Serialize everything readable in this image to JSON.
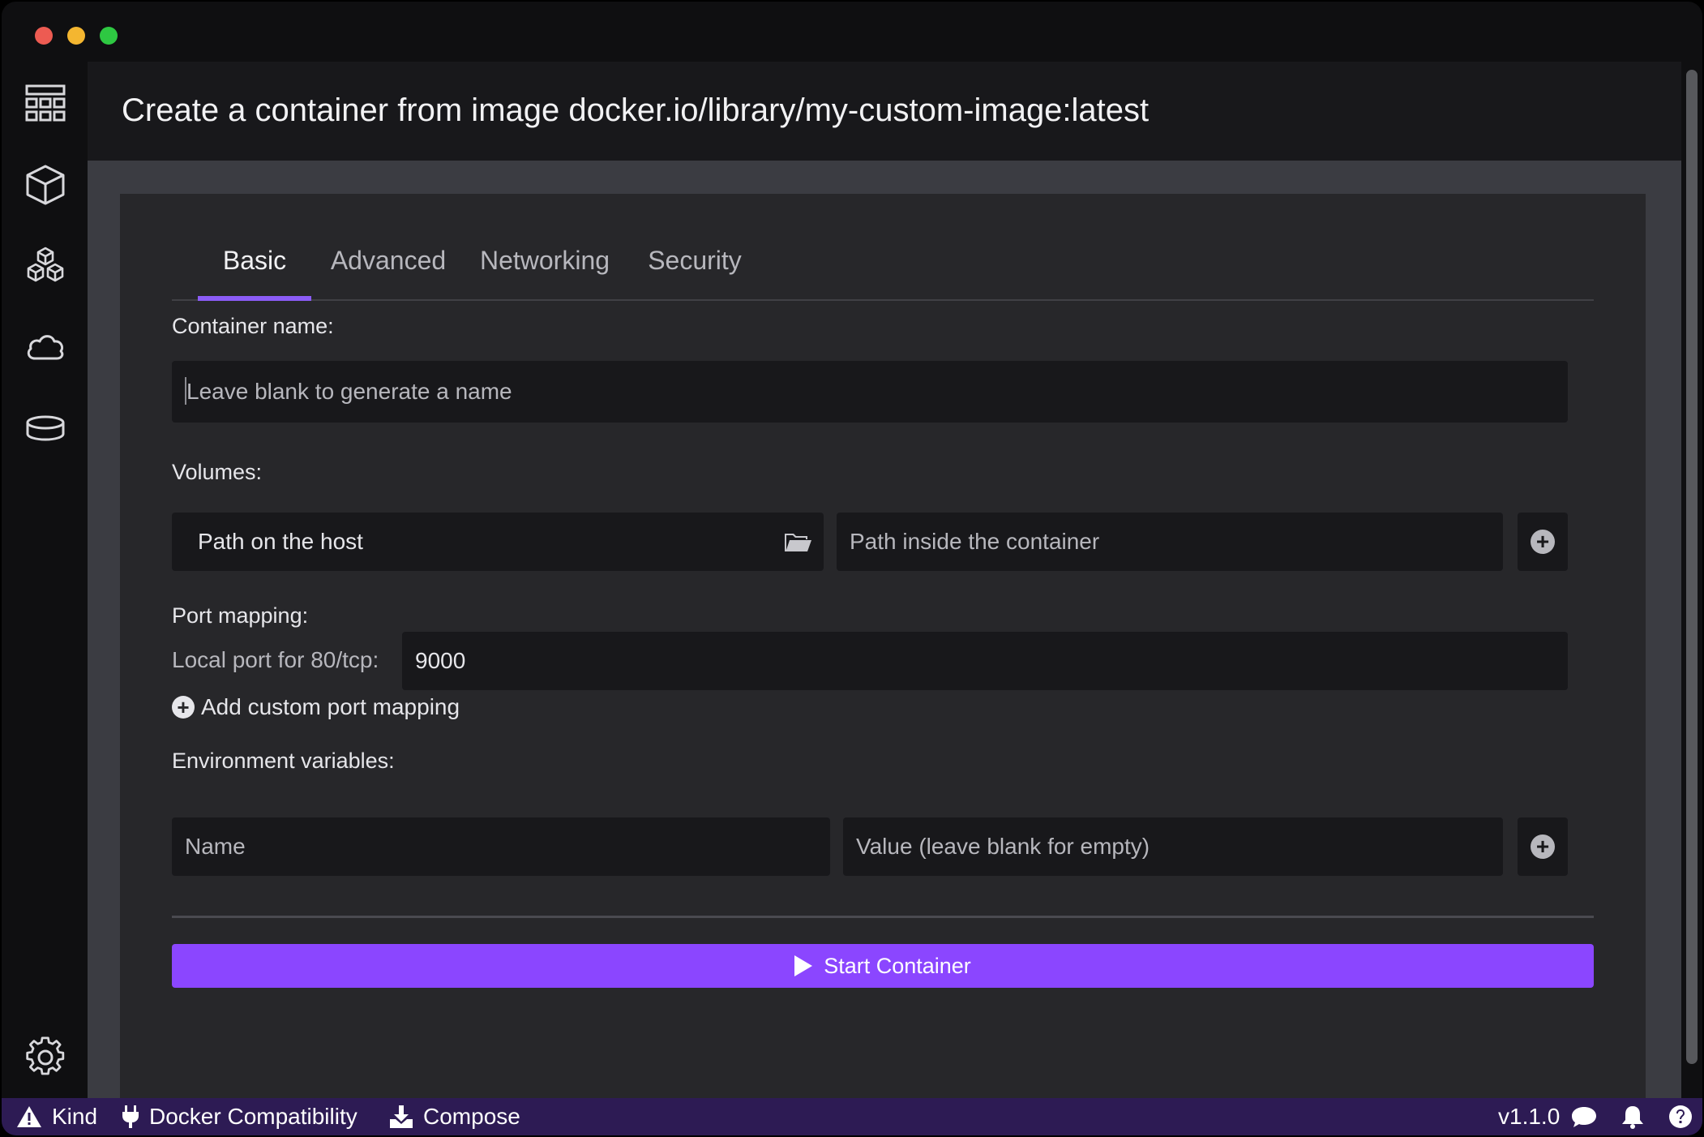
{
  "page": {
    "title": "Create a container from image docker.io/library/my-custom-image:latest"
  },
  "sidebar": {
    "items": [
      {
        "icon": "dashboard-icon"
      },
      {
        "icon": "container-icon"
      },
      {
        "icon": "pods-icon"
      },
      {
        "icon": "cloud-icon"
      },
      {
        "icon": "volume-icon"
      }
    ],
    "settings_icon": "gear-icon"
  },
  "tabs": [
    {
      "label": "Basic",
      "active": true
    },
    {
      "label": "Advanced",
      "active": false
    },
    {
      "label": "Networking",
      "active": false
    },
    {
      "label": "Security",
      "active": false
    }
  ],
  "form": {
    "container_name": {
      "label": "Container name:",
      "placeholder": "Leave blank to generate a name"
    },
    "volumes": {
      "label": "Volumes:",
      "host_path_placeholder": "Path on the host",
      "container_path_placeholder": "Path inside the container"
    },
    "port_mapping": {
      "label": "Port mapping:",
      "local_port_label": "Local port for 80/tcp:",
      "local_port_value": "9000",
      "add_custom_label": "Add custom port mapping"
    },
    "env": {
      "label": "Environment variables:",
      "name_placeholder": "Name",
      "value_placeholder": "Value (leave blank for empty)"
    },
    "start_label": "Start Container"
  },
  "statusbar": {
    "kind": "Kind",
    "docker_compat": "Docker Compatibility",
    "compose": "Compose",
    "version": "v1.1.0"
  },
  "colors": {
    "accent": "#8b46ff",
    "statusbar": "#2d1b54"
  }
}
